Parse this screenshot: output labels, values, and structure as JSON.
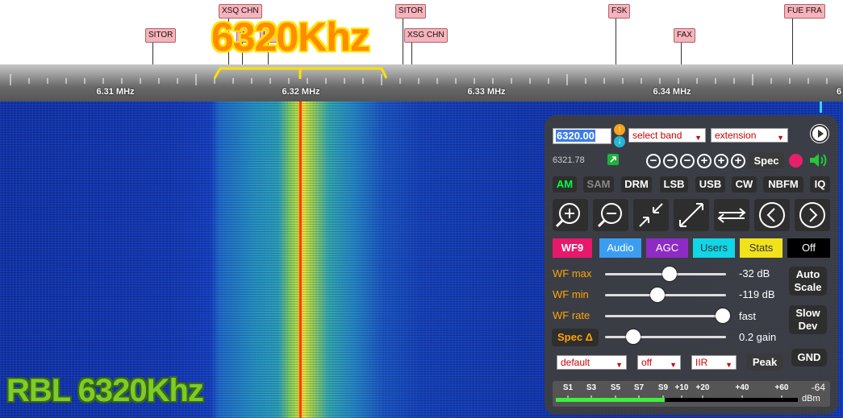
{
  "stations": [
    {
      "label": "SITOR"
    },
    {
      "label": "XSQ CHN"
    },
    {
      "label": "W"
    },
    {
      "label": "USA"
    },
    {
      "label": "SITOR"
    },
    {
      "label": "XSG CHN"
    },
    {
      "label": "FSK"
    },
    {
      "label": "FAX"
    },
    {
      "label": "FUE FRA"
    }
  ],
  "overlay": {
    "freq_big": "6320Khz",
    "station_text": "RBL 6320Khz"
  },
  "scale": {
    "labels": [
      "6.31 MHz",
      "6.32 MHz",
      "6.33 MHz",
      "6.34 MHz",
      "6"
    ]
  },
  "panel": {
    "freq_value": "6320.00",
    "band_select": "select band",
    "extension_select": "extension",
    "cursor_freq": "6321.78",
    "spec_label": "Spec",
    "modes": [
      "AM",
      "SAM",
      "DRM",
      "LSB",
      "USB",
      "CW",
      "NBFM",
      "IQ"
    ],
    "tabs": [
      "WF9",
      "Audio",
      "AGC",
      "Users",
      "Stats",
      "Off"
    ],
    "sliders": [
      {
        "label": "WF max",
        "value": "-32 dB",
        "level": 0.53
      },
      {
        "label": "WF min",
        "value": "-119 dB",
        "level": 0.43
      },
      {
        "label": "WF rate",
        "value": "fast",
        "level": 0.97
      },
      {
        "label": "Spec Δ",
        "value": "0.2 gain",
        "level": 0.23
      }
    ],
    "auto_scale": "Auto Scale",
    "slow_dev": "Slow Dev",
    "gnd": "GND",
    "peak": "Peak",
    "bottom_selects": [
      "default",
      "off",
      "IIR"
    ],
    "meter": {
      "labels": [
        "S1",
        "S3",
        "S5",
        "S7",
        "S9",
        "+10",
        "+20",
        "+40",
        "+60"
      ],
      "reading": "-64",
      "unit": "dBm",
      "level": 0.45
    },
    "colors": {
      "mode_active": "#00ff44",
      "tab_wf": "#e8186a",
      "tab_audio": "#3a9df2",
      "tab_agc": "#8e2bc4",
      "tab_users": "#10d6e8",
      "tab_stats": "#f2e21c",
      "tab_off": "#000000"
    }
  }
}
